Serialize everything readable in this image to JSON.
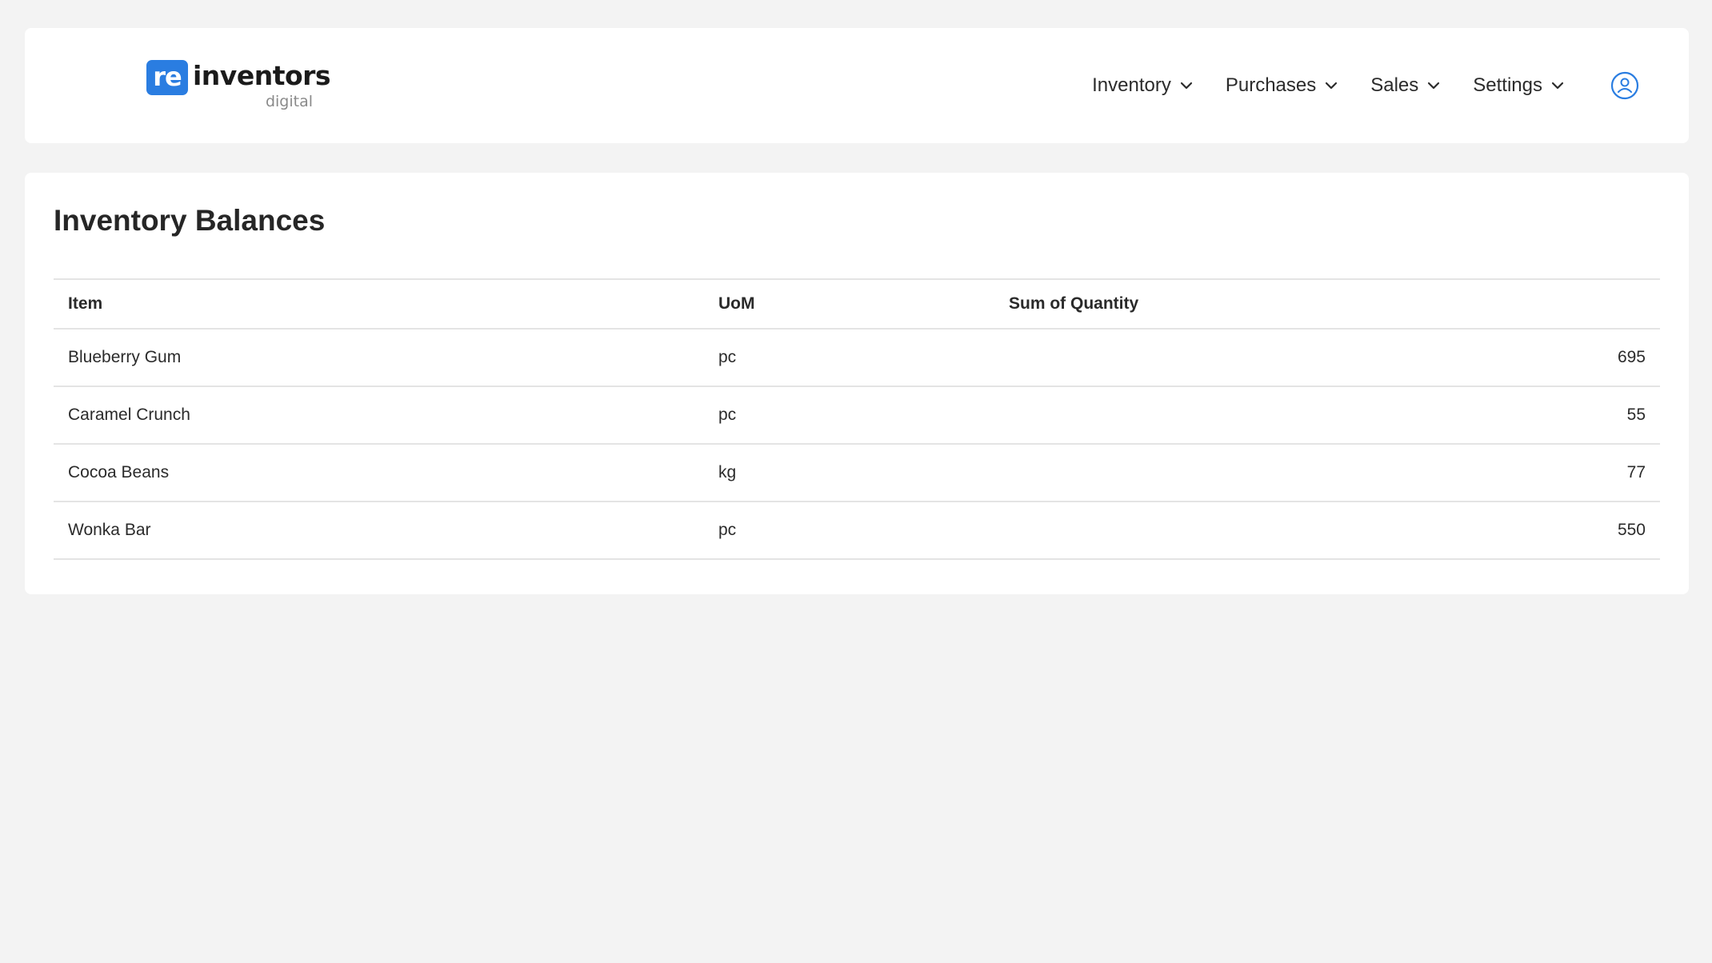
{
  "brand": {
    "badge": "re",
    "word": "inventors",
    "sub": "digital",
    "accent_color": "#2a7de1"
  },
  "nav": {
    "items": [
      {
        "label": "Inventory",
        "icon": "chevron-down-icon"
      },
      {
        "label": "Purchases",
        "icon": "chevron-down-icon"
      },
      {
        "label": "Sales",
        "icon": "chevron-down-icon"
      },
      {
        "label": "Settings",
        "icon": "chevron-down-icon"
      }
    ],
    "user_icon": "user-circle-icon"
  },
  "page": {
    "title": "Inventory Balances"
  },
  "table": {
    "headers": [
      "Item",
      "UoM",
      "Sum of Quantity"
    ],
    "rows": [
      {
        "item": "Blueberry Gum",
        "uom": "pc",
        "qty": "695"
      },
      {
        "item": "Caramel Crunch",
        "uom": "pc",
        "qty": "55"
      },
      {
        "item": "Cocoa Beans",
        "uom": "kg",
        "qty": "77"
      },
      {
        "item": "Wonka Bar",
        "uom": "pc",
        "qty": "550"
      }
    ]
  }
}
